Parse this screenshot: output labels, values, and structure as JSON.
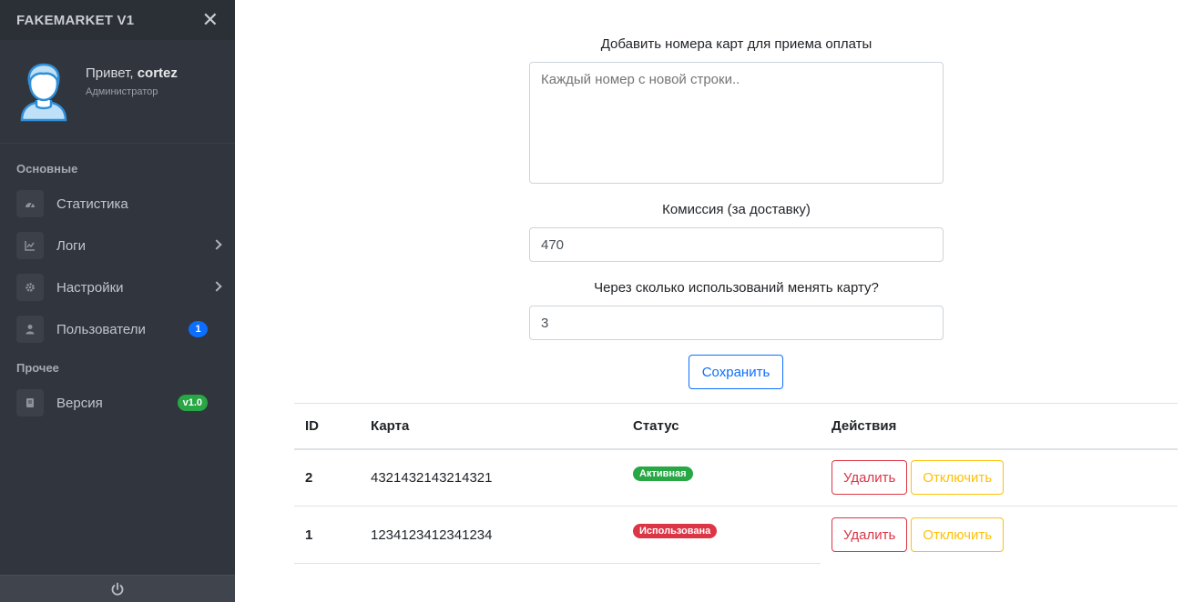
{
  "sidebar": {
    "brand": "FAKEMARKET V1",
    "greeting_prefix": "Привет, ",
    "username": "cortez",
    "role": "Администратор",
    "sections": [
      {
        "title": "Основные"
      },
      {
        "title": "Прочее"
      }
    ],
    "items": [
      {
        "label": "Статистика",
        "icon": "dashboard-icon"
      },
      {
        "label": "Логи",
        "icon": "chart-icon"
      },
      {
        "label": "Настройки",
        "icon": "gear-icon"
      },
      {
        "label": "Пользователи",
        "icon": "user-icon",
        "badge": "1"
      },
      {
        "label": "Версия",
        "icon": "book-icon",
        "badge": "v1.0"
      }
    ]
  },
  "form": {
    "cards_label": "Добавить номера карт для приема оплаты",
    "cards_placeholder": "Каждый номер с новой строки..",
    "commission_label": "Комиссия (за доставку)",
    "commission_value": "470",
    "rotate_label": "Через сколько использований менять карту?",
    "rotate_value": "3",
    "save_label": "Сохранить"
  },
  "table": {
    "headers": [
      "ID",
      "Карта",
      "Статус",
      "Действия"
    ],
    "rows": [
      {
        "id": "2",
        "card": "4321432143214321",
        "status": "Активная",
        "delete": "Удалить",
        "disable": "Отключить"
      },
      {
        "id": "1",
        "card": "1234123412341234",
        "status": "Использована",
        "delete": "Удалить",
        "disable": "Отключить"
      }
    ]
  },
  "colors": {
    "sidebar_bg": "#31353d",
    "primary": "#0d6efd",
    "success": "#28a745",
    "danger": "#dc3545",
    "warning": "#ffc107"
  }
}
